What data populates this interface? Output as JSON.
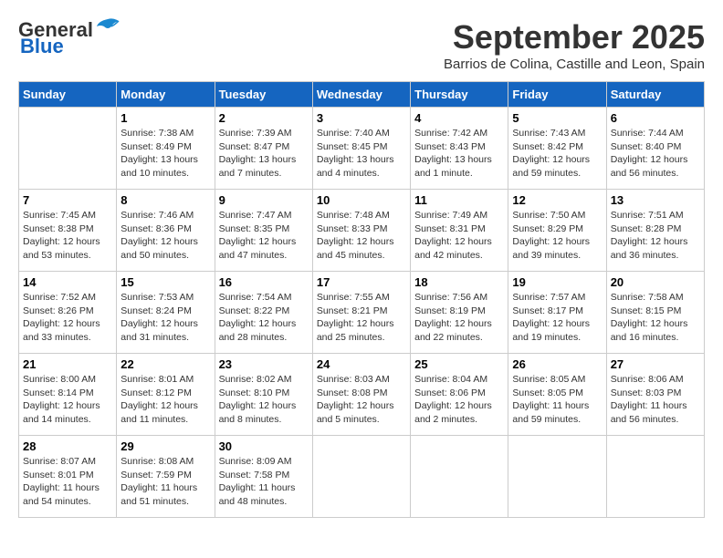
{
  "header": {
    "logo_general": "General",
    "logo_blue": "Blue",
    "month_title": "September 2025",
    "location": "Barrios de Colina, Castille and Leon, Spain"
  },
  "days_of_week": [
    "Sunday",
    "Monday",
    "Tuesday",
    "Wednesday",
    "Thursday",
    "Friday",
    "Saturday"
  ],
  "weeks": [
    [
      {
        "day": "",
        "info": ""
      },
      {
        "day": "1",
        "info": "Sunrise: 7:38 AM\nSunset: 8:49 PM\nDaylight: 13 hours\nand 10 minutes."
      },
      {
        "day": "2",
        "info": "Sunrise: 7:39 AM\nSunset: 8:47 PM\nDaylight: 13 hours\nand 7 minutes."
      },
      {
        "day": "3",
        "info": "Sunrise: 7:40 AM\nSunset: 8:45 PM\nDaylight: 13 hours\nand 4 minutes."
      },
      {
        "day": "4",
        "info": "Sunrise: 7:42 AM\nSunset: 8:43 PM\nDaylight: 13 hours\nand 1 minute."
      },
      {
        "day": "5",
        "info": "Sunrise: 7:43 AM\nSunset: 8:42 PM\nDaylight: 12 hours\nand 59 minutes."
      },
      {
        "day": "6",
        "info": "Sunrise: 7:44 AM\nSunset: 8:40 PM\nDaylight: 12 hours\nand 56 minutes."
      }
    ],
    [
      {
        "day": "7",
        "info": "Sunrise: 7:45 AM\nSunset: 8:38 PM\nDaylight: 12 hours\nand 53 minutes."
      },
      {
        "day": "8",
        "info": "Sunrise: 7:46 AM\nSunset: 8:36 PM\nDaylight: 12 hours\nand 50 minutes."
      },
      {
        "day": "9",
        "info": "Sunrise: 7:47 AM\nSunset: 8:35 PM\nDaylight: 12 hours\nand 47 minutes."
      },
      {
        "day": "10",
        "info": "Sunrise: 7:48 AM\nSunset: 8:33 PM\nDaylight: 12 hours\nand 45 minutes."
      },
      {
        "day": "11",
        "info": "Sunrise: 7:49 AM\nSunset: 8:31 PM\nDaylight: 12 hours\nand 42 minutes."
      },
      {
        "day": "12",
        "info": "Sunrise: 7:50 AM\nSunset: 8:29 PM\nDaylight: 12 hours\nand 39 minutes."
      },
      {
        "day": "13",
        "info": "Sunrise: 7:51 AM\nSunset: 8:28 PM\nDaylight: 12 hours\nand 36 minutes."
      }
    ],
    [
      {
        "day": "14",
        "info": "Sunrise: 7:52 AM\nSunset: 8:26 PM\nDaylight: 12 hours\nand 33 minutes."
      },
      {
        "day": "15",
        "info": "Sunrise: 7:53 AM\nSunset: 8:24 PM\nDaylight: 12 hours\nand 31 minutes."
      },
      {
        "day": "16",
        "info": "Sunrise: 7:54 AM\nSunset: 8:22 PM\nDaylight: 12 hours\nand 28 minutes."
      },
      {
        "day": "17",
        "info": "Sunrise: 7:55 AM\nSunset: 8:21 PM\nDaylight: 12 hours\nand 25 minutes."
      },
      {
        "day": "18",
        "info": "Sunrise: 7:56 AM\nSunset: 8:19 PM\nDaylight: 12 hours\nand 22 minutes."
      },
      {
        "day": "19",
        "info": "Sunrise: 7:57 AM\nSunset: 8:17 PM\nDaylight: 12 hours\nand 19 minutes."
      },
      {
        "day": "20",
        "info": "Sunrise: 7:58 AM\nSunset: 8:15 PM\nDaylight: 12 hours\nand 16 minutes."
      }
    ],
    [
      {
        "day": "21",
        "info": "Sunrise: 8:00 AM\nSunset: 8:14 PM\nDaylight: 12 hours\nand 14 minutes."
      },
      {
        "day": "22",
        "info": "Sunrise: 8:01 AM\nSunset: 8:12 PM\nDaylight: 12 hours\nand 11 minutes."
      },
      {
        "day": "23",
        "info": "Sunrise: 8:02 AM\nSunset: 8:10 PM\nDaylight: 12 hours\nand 8 minutes."
      },
      {
        "day": "24",
        "info": "Sunrise: 8:03 AM\nSunset: 8:08 PM\nDaylight: 12 hours\nand 5 minutes."
      },
      {
        "day": "25",
        "info": "Sunrise: 8:04 AM\nSunset: 8:06 PM\nDaylight: 12 hours\nand 2 minutes."
      },
      {
        "day": "26",
        "info": "Sunrise: 8:05 AM\nSunset: 8:05 PM\nDaylight: 11 hours\nand 59 minutes."
      },
      {
        "day": "27",
        "info": "Sunrise: 8:06 AM\nSunset: 8:03 PM\nDaylight: 11 hours\nand 56 minutes."
      }
    ],
    [
      {
        "day": "28",
        "info": "Sunrise: 8:07 AM\nSunset: 8:01 PM\nDaylight: 11 hours\nand 54 minutes."
      },
      {
        "day": "29",
        "info": "Sunrise: 8:08 AM\nSunset: 7:59 PM\nDaylight: 11 hours\nand 51 minutes."
      },
      {
        "day": "30",
        "info": "Sunrise: 8:09 AM\nSunset: 7:58 PM\nDaylight: 11 hours\nand 48 minutes."
      },
      {
        "day": "",
        "info": ""
      },
      {
        "day": "",
        "info": ""
      },
      {
        "day": "",
        "info": ""
      },
      {
        "day": "",
        "info": ""
      }
    ]
  ]
}
